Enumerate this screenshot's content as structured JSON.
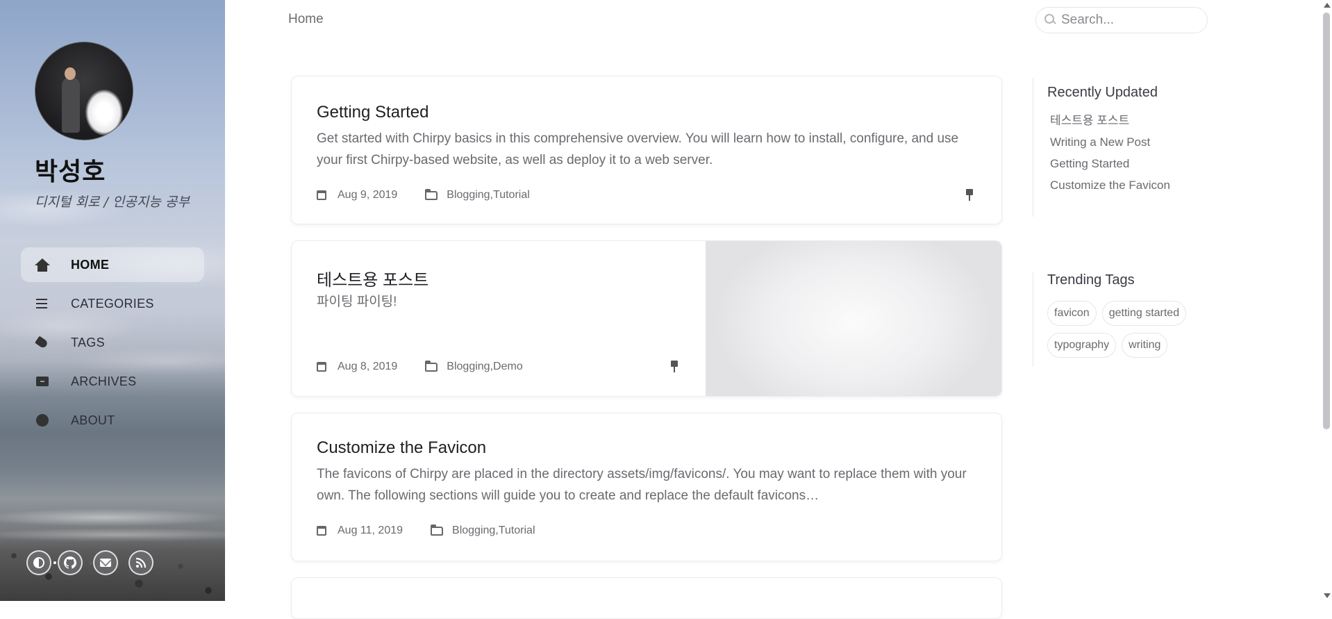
{
  "sidebar": {
    "title": "박성호",
    "subtitle": "디지털 회로 / 인공지능 공부",
    "nav": [
      {
        "label": "HOME",
        "icon": "home-icon",
        "active": true
      },
      {
        "label": "CATEGORIES",
        "icon": "bars-icon",
        "active": false
      },
      {
        "label": "TAGS",
        "icon": "tags-icon",
        "active": false
      },
      {
        "label": "ARCHIVES",
        "icon": "archive-icon",
        "active": false
      },
      {
        "label": "ABOUT",
        "icon": "info-icon",
        "active": false
      }
    ],
    "social": [
      "mode-toggle-icon",
      "github-icon",
      "email-icon",
      "rss-icon"
    ]
  },
  "topbar": {
    "breadcrumb": "Home",
    "search_placeholder": "Search..."
  },
  "posts": [
    {
      "title": "Getting Started",
      "excerpt": "Get started with Chirpy basics in this comprehensive overview. You will learn how to install, configure, and use your first Chirpy-based website, as well as deploy it to a web server.",
      "date": "Aug 9, 2019",
      "category_1": "Blogging",
      "category_2": "Tutorial",
      "pinned": true
    },
    {
      "title": "테스트용 포스트",
      "excerpt": "파이팅 파이팅!",
      "date": "Aug 8, 2019",
      "category_1": "Blogging",
      "category_2": "Demo",
      "pinned": true
    },
    {
      "title": "Customize the Favicon",
      "excerpt": "The favicons of Chirpy are placed in the directory assets/img/favicons/. You may want to replace them with your own. The following sections will guide you to create and replace the default favicons…",
      "date": "Aug 11, 2019",
      "category_1": "Blogging",
      "category_2": "Tutorial",
      "pinned": false
    }
  ],
  "panel": {
    "recent_title": "Recently Updated",
    "recent": [
      "테스트용 포스트",
      "Writing a New Post",
      "Getting Started",
      "Customize the Favicon"
    ],
    "tags_title": "Trending Tags",
    "tags": [
      "favicon",
      "getting started",
      "typography",
      "writing"
    ]
  }
}
